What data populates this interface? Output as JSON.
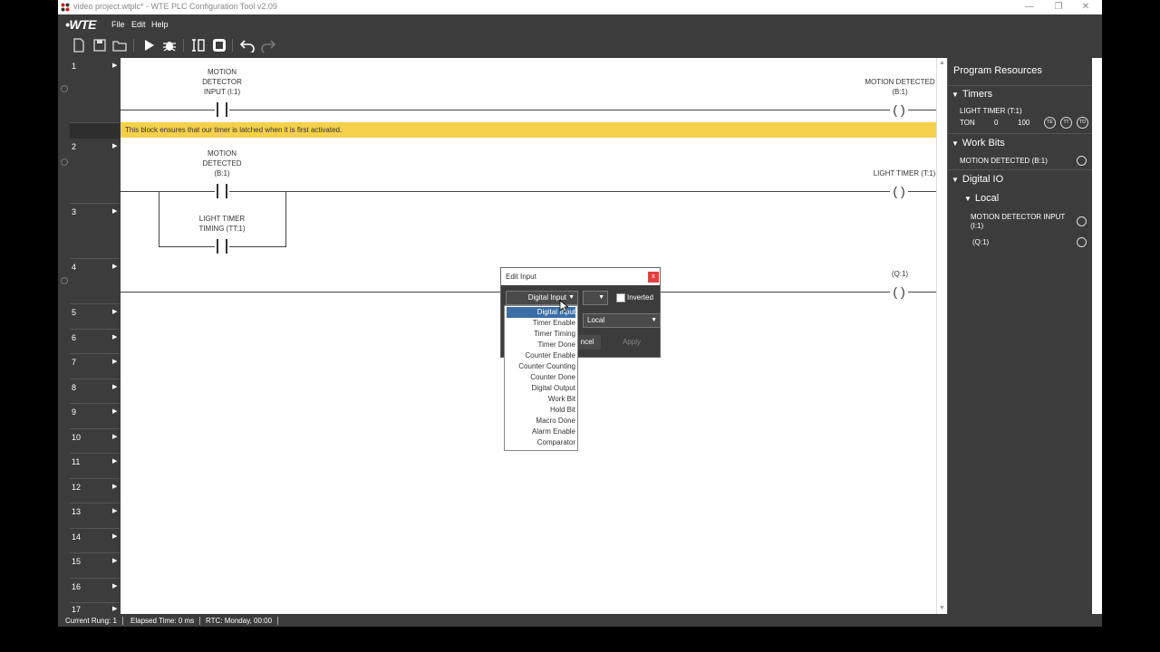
{
  "window": {
    "title": "video project.wtplc* - WTE PLC Configuration Tool v2.09"
  },
  "menubar": {
    "logo": "•WTE",
    "items": [
      "File",
      "Edit",
      "Help"
    ]
  },
  "toolbar": {
    "icons": [
      "new-file-icon",
      "save-icon",
      "open-folder-icon",
      "run-icon",
      "debug-icon",
      "io-icon",
      "stop-icon",
      "undo-icon",
      "redo-icon"
    ]
  },
  "rungs": [
    {
      "number": "1"
    },
    {
      "number": "2"
    },
    {
      "number": "3"
    },
    {
      "number": "4"
    },
    {
      "number": "5"
    },
    {
      "number": "6"
    },
    {
      "number": "7"
    },
    {
      "number": "8"
    },
    {
      "number": "9"
    },
    {
      "number": "10"
    },
    {
      "number": "11"
    },
    {
      "number": "12"
    },
    {
      "number": "13"
    },
    {
      "number": "14"
    },
    {
      "number": "15"
    },
    {
      "number": "16"
    },
    {
      "number": "17"
    }
  ],
  "ladder": {
    "rung1_contact_line1": "MOTION",
    "rung1_contact_line2": "DETECTOR",
    "rung1_contact_line3": "INPUT (I:1)",
    "rung1_coil_line1": "MOTION DETECTED",
    "rung1_coil_line2": "(B:1)",
    "comment": "This block ensures that our timer is latched when it is first activated.",
    "rung2_contact_line1": "MOTION",
    "rung2_contact_line2": "DETECTED",
    "rung2_contact_line3": "(B:1)",
    "rung2_coil": "LIGHT TIMER (T:1)",
    "rung3_contact_line1": "LIGHT TIMER",
    "rung3_contact_line2": "TIMING (TT:1)",
    "rung4_coil": "(Q:1)"
  },
  "resources": {
    "title": "Program Resources",
    "timers_header": "Timers",
    "timer_name": "LIGHT TIMER (T:1)",
    "timer_type": "TON",
    "timer_acc": "0",
    "timer_preset": "100",
    "timer_badges": [
      "TE",
      "TT",
      "TD"
    ],
    "workbits_header": "Work Bits",
    "workbit_name": "MOTION DETECTED (B:1)",
    "digitalio_header": "Digital IO",
    "local_header": "Local",
    "io_item1_line1": "MOTION DETECTOR INPUT",
    "io_item1_line2": "(I:1)",
    "io_item2": "(Q:1)"
  },
  "status": {
    "current_rung": "Current Rung: 1",
    "elapsed": "Elapsed Time: 0 ms",
    "rtc": "RTC: Monday, 00:00"
  },
  "dialog": {
    "title": "Edit Input",
    "close": "x",
    "type_value": "Digital Input",
    "inverted_label": "Inverted",
    "location_value": "Local",
    "cancel_label": "ncel",
    "apply_label": "Apply"
  },
  "dropdown": {
    "items": [
      "Digital Input",
      "Timer Enable",
      "Timer Timing",
      "Timer Done",
      "Counter Enable",
      "Counter Counting",
      "Counter Done",
      "Digital Output",
      "Work Bit",
      "Hold Bit",
      "Macro Done",
      "Alarm Enable",
      "Comparator"
    ],
    "selected": "Digital Input"
  }
}
